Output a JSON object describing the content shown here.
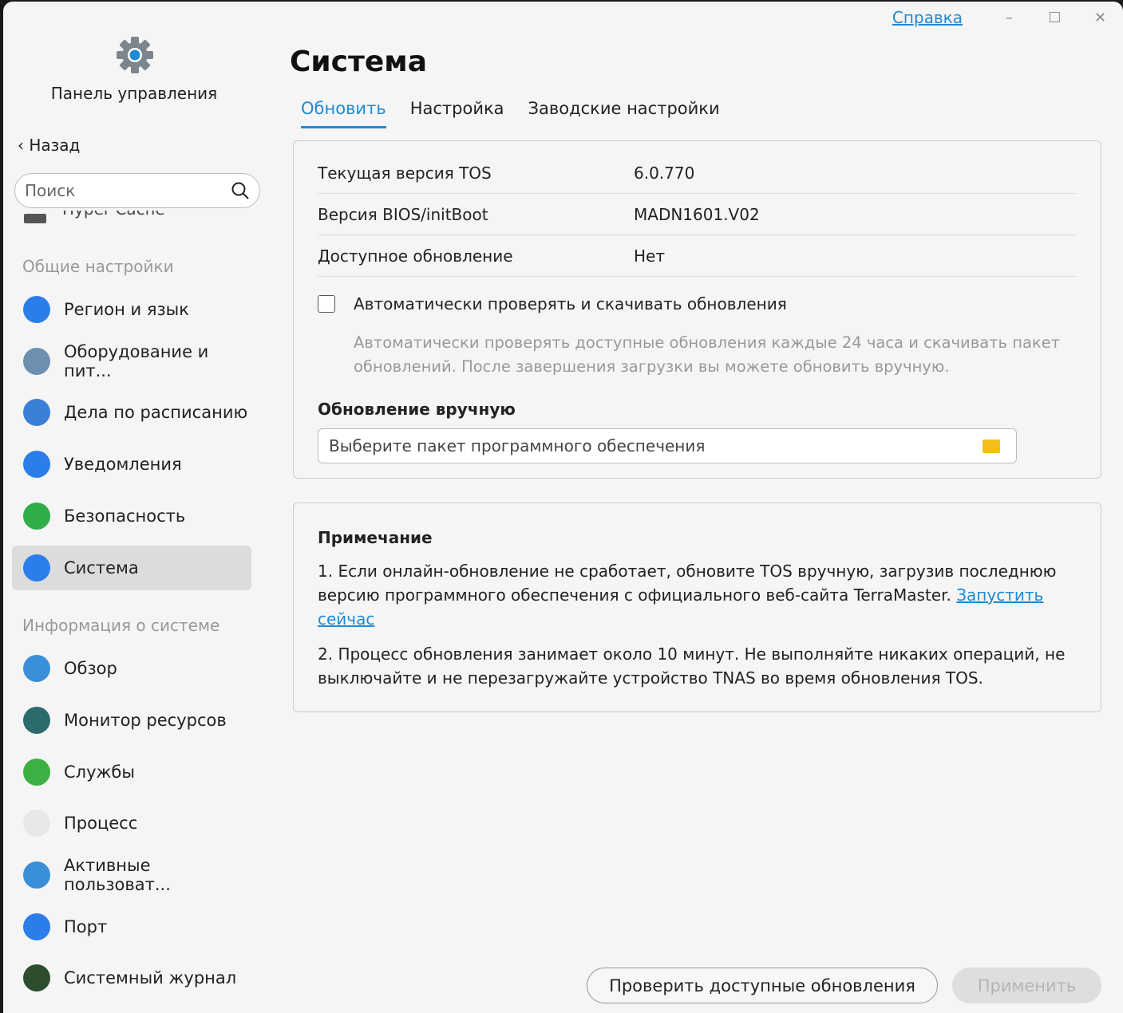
{
  "window": {
    "help": "Справка",
    "minimize": "–",
    "maximize": "☐",
    "close": "✕"
  },
  "sidebar": {
    "app_title": "Панель управления",
    "back": "Назад",
    "search_placeholder": "Поиск",
    "clipped_item": "Hyper Cache",
    "sections": [
      {
        "title": "Общие настройки",
        "items": [
          {
            "label": "Регион и язык",
            "icon": "globe-icon",
            "color": "#2b7de9"
          },
          {
            "label": "Оборудование и пит...",
            "icon": "tools-icon",
            "color": "#6d8fb0"
          },
          {
            "label": "Дела по расписанию",
            "icon": "schedule-icon",
            "color": "#3a7fd8"
          },
          {
            "label": "Уведомления",
            "icon": "chat-icon",
            "color": "#2b7de9"
          },
          {
            "label": "Безопасность",
            "icon": "shield-icon",
            "color": "#2fae4a"
          },
          {
            "label": "Система",
            "icon": "system-update-icon",
            "color": "#2b7de9",
            "selected": true
          }
        ]
      },
      {
        "title": "Информация о системе",
        "items": [
          {
            "label": "Обзор",
            "icon": "monitor-info-icon",
            "color": "#3a8fd8"
          },
          {
            "label": "Монитор ресурсов",
            "icon": "resource-monitor-icon",
            "color": "#2d6b6b"
          },
          {
            "label": "Службы",
            "icon": "services-icon",
            "color": "#3cb043"
          },
          {
            "label": "Процесс",
            "icon": "process-icon",
            "color": "#e8e8e8"
          },
          {
            "label": "Активные пользоват...",
            "icon": "active-users-icon",
            "color": "#3a8fd8"
          },
          {
            "label": "Порт",
            "icon": "port-icon",
            "color": "#2b7de9"
          },
          {
            "label": "Системный журнал",
            "icon": "log-icon",
            "color": "#2e4d2e"
          }
        ]
      }
    ]
  },
  "main": {
    "title": "Система",
    "tabs": [
      "Обновить",
      "Настройка",
      "Заводские настройки"
    ],
    "info": [
      {
        "key": "Текущая версия TOS",
        "value": "6.0.770"
      },
      {
        "key": "Версия BIOS/initBoot",
        "value": "MADN1601.V02"
      },
      {
        "key": "Доступное обновление",
        "value": "Нет"
      }
    ],
    "auto_check_label": "Автоматически проверять и скачивать обновления",
    "auto_check_desc": "Автоматически проверять доступные обновления каждые 24 часа и скачивать пакет обновлений. После завершения загрузки вы можете обновить вручную.",
    "manual_label": "Обновление вручную",
    "file_placeholder": "Выберите пакет программного обеспечения",
    "note": {
      "title": "Примечание",
      "p1": "1. Если онлайн-обновление не сработает, обновите TOS вручную, загрузив последнюю версию программного обеспечения с официального веб-сайта TerraMaster. ",
      "p1_link": "Запустить сейчас",
      "p2": "2. Процесс обновления занимает около 10 минут. Не выполняйте никаких операций, не выключайте и не перезагружайте устройство TNAS во время обновления TOS."
    },
    "check_button": "Проверить доступные обновления",
    "apply_button": "Применить"
  }
}
